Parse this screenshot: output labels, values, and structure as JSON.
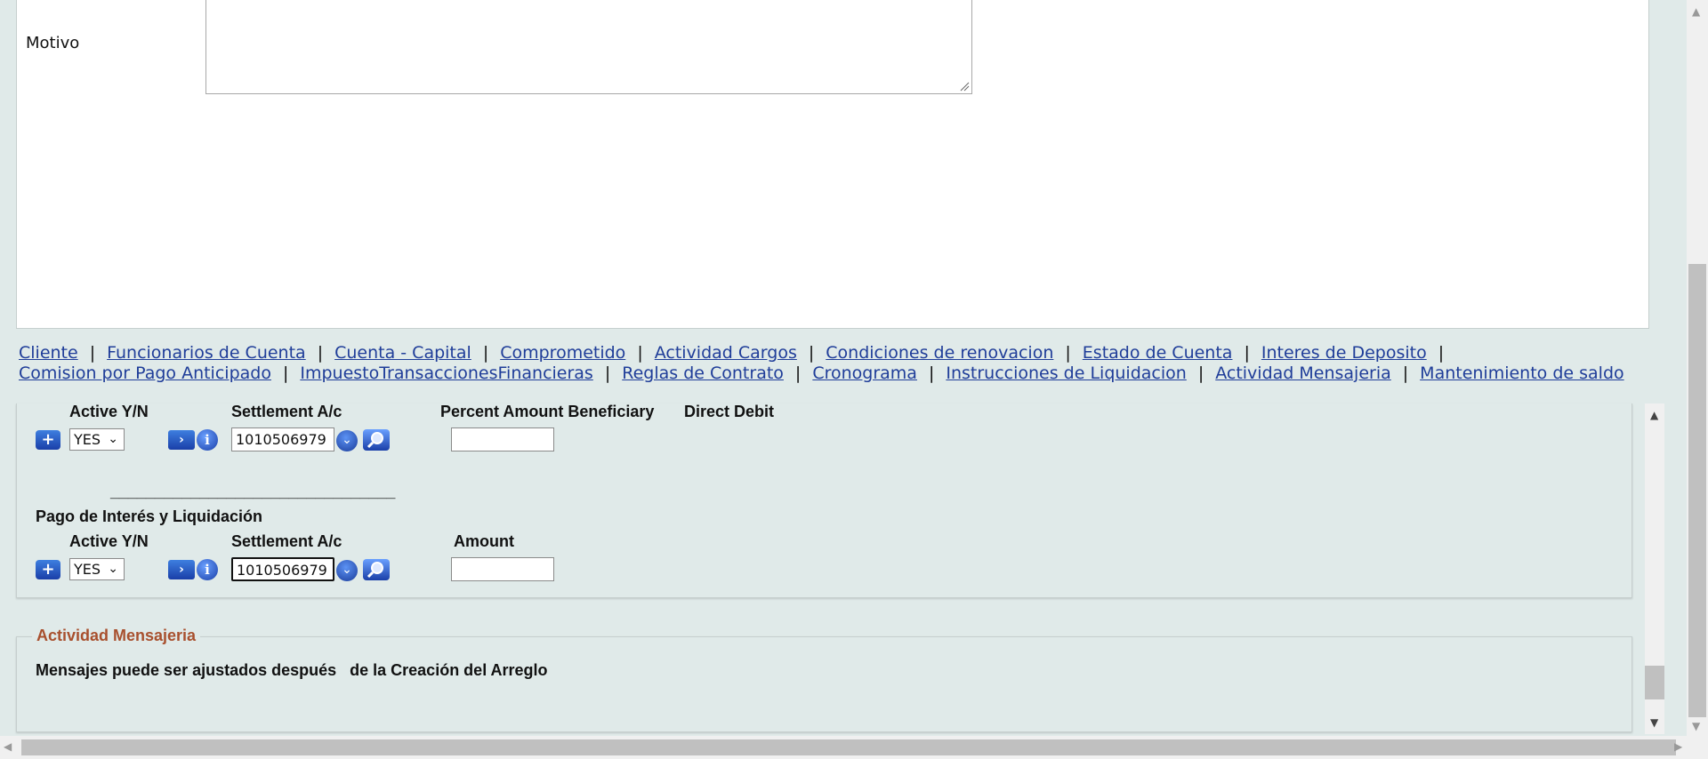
{
  "form": {
    "motivo_label": "Motivo"
  },
  "nav_links": {
    "row1": [
      "Cliente",
      "Funcionarios de Cuenta",
      "Cuenta - Capital",
      "Comprometido",
      "Actividad Cargos",
      "Condiciones de renovacion",
      "Estado de Cuenta",
      "Interes de Deposito"
    ],
    "row2": [
      "Comision por Pago Anticipado",
      "ImpuestoTransaccionesFinancieras",
      "Reglas de Contrato",
      "Cronograma",
      "Instrucciones de Liquidacion",
      "Actividad Mensajeria",
      "Mantenimiento de saldo"
    ],
    "separator": "|"
  },
  "section1": {
    "col_active": "Active Y/N",
    "col_settlement": "Settlement A/c",
    "col_percent": "Percent Amount Beneficiary",
    "col_direct_debit": "Direct Debit",
    "active_value": "YES",
    "account_value": "1010506979"
  },
  "divider_text": "________________________________",
  "section2": {
    "title": "Pago de Interés y Liquidación",
    "col_active": "Active Y/N",
    "col_settlement": "Settlement A/c",
    "col_amount": "Amount",
    "active_value": "YES",
    "account_value": "1010506979"
  },
  "messaging": {
    "legend": "Actividad Mensajeria",
    "text": "Mensajes puede ser ajustados después   de la Creación del Arreglo"
  },
  "icons": {
    "add": "+",
    "go": "›",
    "info": "i",
    "dropdown": "⌄",
    "chevron": "⌄"
  },
  "colors": {
    "background": "#e0eae9",
    "link": "#1f3d99",
    "legend": "#a8502e",
    "button_blue": "#1a3fa8"
  }
}
